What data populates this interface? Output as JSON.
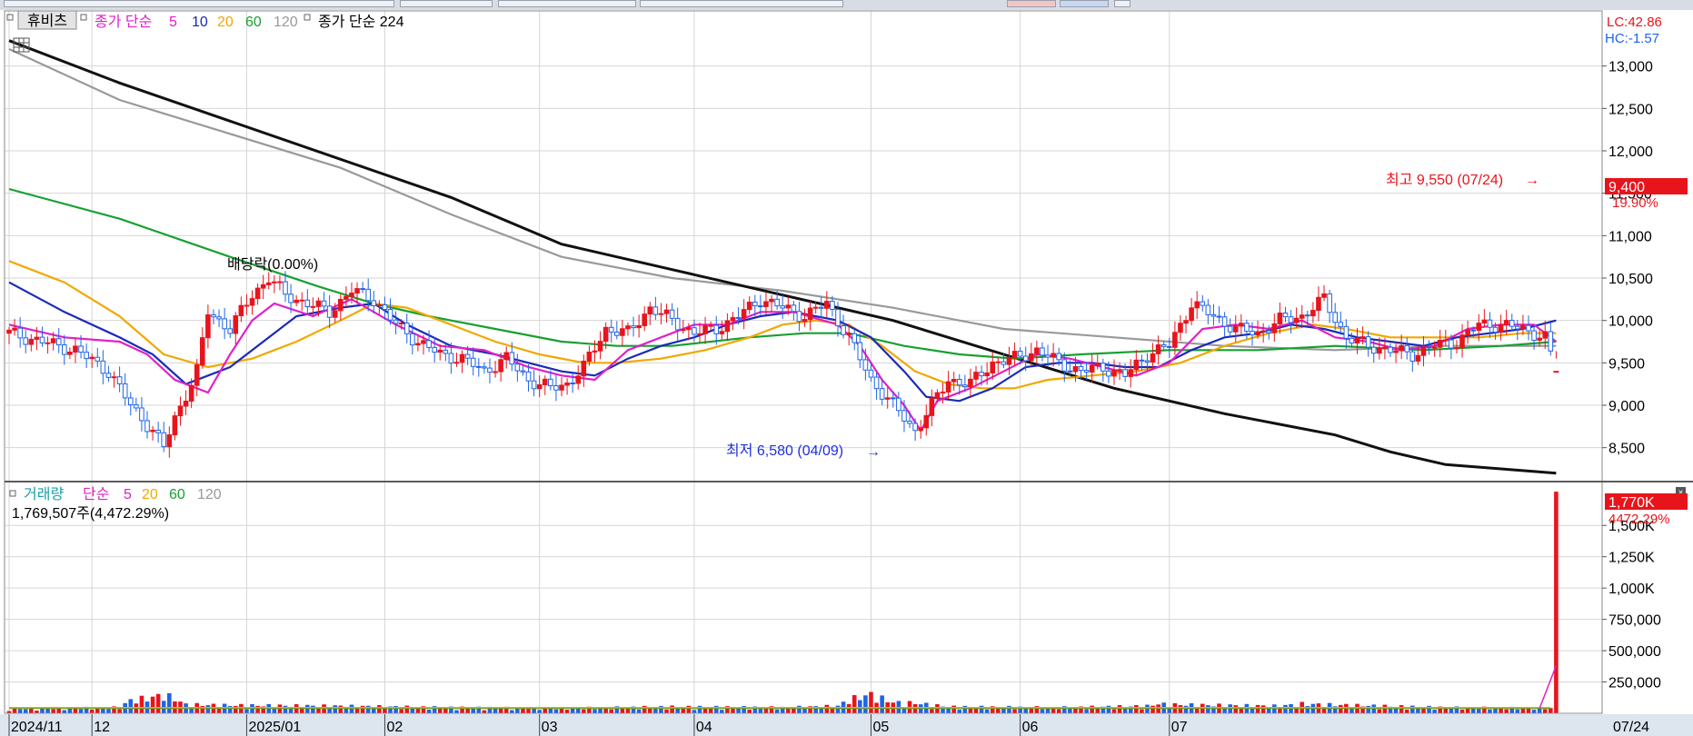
{
  "toolbar": {
    "stock_button": "휴비츠"
  },
  "price_legend": {
    "ma_prefix": "종가 단순",
    "periods": [
      "5",
      "10",
      "20",
      "60",
      "120"
    ],
    "ma_224_label": "종가 단순 224"
  },
  "volume_legend": {
    "title": "거래량",
    "prefix": "단순",
    "periods": [
      "5",
      "20",
      "60",
      "120"
    ],
    "value_text": "1,769,507주(4,472.29%)"
  },
  "colors": {
    "up": "#e8141c",
    "down": "#1e64e8",
    "ma5": "#e020c8",
    "ma10": "#1a2ab8",
    "ma20": "#f0a800",
    "ma60": "#18a030",
    "ma120": "#999999",
    "ma224": "#111111",
    "grid": "#d6d6d6"
  },
  "chart_data": [
    {
      "type": "candlestick",
      "title": "휴비츠",
      "y_ticks": [
        "13,000",
        "12,500",
        "12,000",
        "11,500",
        "11,000",
        "10,500",
        "10,000",
        "9,500",
        "9,000",
        "8,500"
      ],
      "ylim": [
        8100,
        13650
      ],
      "x_ticks": [
        "2024/11",
        "12",
        "2025/01",
        "02",
        "03",
        "04",
        "05",
        "06",
        "07"
      ],
      "last_date_label": "07/24",
      "indicators": {
        "lc": "LC:42.86",
        "hc": "HC:-1.57"
      },
      "current_price": "9,400",
      "current_change": "19.90%",
      "annotations": {
        "high": "최고 9,550 (07/24)",
        "low": "최저 6,580 (04/09)",
        "dividend": "배당락(0.00%)"
      },
      "ma_lines": {
        "ma5": [
          [
            0,
            9950
          ],
          [
            10,
            9800
          ],
          [
            20,
            9750
          ],
          [
            25,
            9600
          ],
          [
            30,
            9300
          ],
          [
            36,
            9150
          ],
          [
            40,
            9600
          ],
          [
            44,
            10000
          ],
          [
            48,
            10200
          ],
          [
            55,
            10050
          ],
          [
            62,
            10250
          ],
          [
            70,
            9950
          ],
          [
            78,
            9700
          ],
          [
            86,
            9650
          ],
          [
            94,
            9450
          ],
          [
            100,
            9350
          ],
          [
            106,
            9300
          ],
          [
            112,
            9650
          ],
          [
            118,
            9800
          ],
          [
            124,
            9950
          ],
          [
            130,
            9950
          ],
          [
            136,
            10100
          ],
          [
            142,
            10100
          ],
          [
            150,
            9950
          ],
          [
            154,
            9700
          ],
          [
            158,
            9300
          ],
          [
            162,
            9000
          ],
          [
            165,
            8700
          ],
          [
            168,
            9050
          ],
          [
            174,
            9200
          ],
          [
            180,
            9400
          ],
          [
            186,
            9600
          ],
          [
            192,
            9550
          ],
          [
            198,
            9450
          ],
          [
            204,
            9350
          ],
          [
            210,
            9500
          ],
          [
            216,
            9900
          ],
          [
            222,
            9950
          ],
          [
            228,
            9900
          ],
          [
            234,
            10000
          ],
          [
            240,
            9800
          ],
          [
            246,
            9750
          ],
          [
            252,
            9650
          ],
          [
            258,
            9700
          ],
          [
            264,
            9900
          ],
          [
            270,
            9950
          ],
          [
            276,
            9950
          ],
          [
            280,
            9750
          ]
        ],
        "ma10": [
          [
            0,
            10450
          ],
          [
            10,
            10100
          ],
          [
            20,
            9800
          ],
          [
            26,
            9600
          ],
          [
            32,
            9250
          ],
          [
            40,
            9450
          ],
          [
            46,
            9750
          ],
          [
            52,
            10050
          ],
          [
            60,
            10150
          ],
          [
            66,
            10200
          ],
          [
            72,
            9950
          ],
          [
            80,
            9700
          ],
          [
            88,
            9600
          ],
          [
            94,
            9500
          ],
          [
            100,
            9400
          ],
          [
            106,
            9350
          ],
          [
            112,
            9550
          ],
          [
            118,
            9700
          ],
          [
            124,
            9800
          ],
          [
            130,
            9950
          ],
          [
            136,
            10050
          ],
          [
            142,
            10100
          ],
          [
            150,
            10000
          ],
          [
            156,
            9800
          ],
          [
            162,
            9400
          ],
          [
            166,
            9100
          ],
          [
            172,
            9050
          ],
          [
            178,
            9200
          ],
          [
            184,
            9450
          ],
          [
            190,
            9500
          ],
          [
            196,
            9500
          ],
          [
            202,
            9450
          ],
          [
            208,
            9450
          ],
          [
            214,
            9650
          ],
          [
            220,
            9800
          ],
          [
            226,
            9850
          ],
          [
            232,
            9950
          ],
          [
            238,
            9900
          ],
          [
            244,
            9800
          ],
          [
            250,
            9750
          ],
          [
            256,
            9700
          ],
          [
            262,
            9800
          ],
          [
            268,
            9850
          ],
          [
            274,
            9900
          ],
          [
            280,
            10000
          ]
        ],
        "ma20": [
          [
            0,
            10700
          ],
          [
            10,
            10450
          ],
          [
            20,
            10050
          ],
          [
            28,
            9600
          ],
          [
            36,
            9450
          ],
          [
            44,
            9550
          ],
          [
            52,
            9750
          ],
          [
            60,
            10000
          ],
          [
            66,
            10200
          ],
          [
            72,
            10150
          ],
          [
            80,
            9950
          ],
          [
            88,
            9750
          ],
          [
            96,
            9600
          ],
          [
            104,
            9500
          ],
          [
            110,
            9500
          ],
          [
            118,
            9550
          ],
          [
            126,
            9650
          ],
          [
            134,
            9800
          ],
          [
            140,
            9950
          ],
          [
            146,
            10000
          ],
          [
            152,
            9950
          ],
          [
            158,
            9700
          ],
          [
            164,
            9400
          ],
          [
            170,
            9250
          ],
          [
            176,
            9200
          ],
          [
            182,
            9200
          ],
          [
            188,
            9300
          ],
          [
            196,
            9350
          ],
          [
            204,
            9400
          ],
          [
            212,
            9500
          ],
          [
            220,
            9700
          ],
          [
            228,
            9850
          ],
          [
            236,
            9950
          ],
          [
            242,
            9900
          ],
          [
            250,
            9800
          ],
          [
            258,
            9800
          ],
          [
            266,
            9800
          ],
          [
            274,
            9850
          ],
          [
            280,
            9850
          ]
        ],
        "ma60": [
          [
            0,
            11550
          ],
          [
            20,
            11200
          ],
          [
            40,
            10750
          ],
          [
            56,
            10400
          ],
          [
            66,
            10200
          ],
          [
            76,
            10050
          ],
          [
            88,
            9900
          ],
          [
            100,
            9750
          ],
          [
            110,
            9700
          ],
          [
            120,
            9700
          ],
          [
            134,
            9800
          ],
          [
            144,
            9850
          ],
          [
            152,
            9850
          ],
          [
            162,
            9700
          ],
          [
            172,
            9600
          ],
          [
            182,
            9550
          ],
          [
            194,
            9600
          ],
          [
            210,
            9650
          ],
          [
            226,
            9650
          ],
          [
            240,
            9700
          ],
          [
            256,
            9650
          ],
          [
            270,
            9700
          ],
          [
            280,
            9750
          ]
        ],
        "ma120": [
          [
            0,
            13200
          ],
          [
            20,
            12600
          ],
          [
            40,
            12200
          ],
          [
            60,
            11800
          ],
          [
            80,
            11250
          ],
          [
            100,
            10750
          ],
          [
            120,
            10500
          ],
          [
            140,
            10350
          ],
          [
            160,
            10150
          ],
          [
            180,
            9900
          ],
          [
            200,
            9800
          ],
          [
            220,
            9700
          ],
          [
            240,
            9650
          ],
          [
            260,
            9700
          ],
          [
            280,
            9700
          ]
        ],
        "ma224": [
          [
            0,
            13300
          ],
          [
            20,
            12800
          ],
          [
            40,
            12350
          ],
          [
            60,
            11900
          ],
          [
            80,
            11450
          ],
          [
            100,
            10900
          ],
          [
            120,
            10600
          ],
          [
            140,
            10300
          ],
          [
            160,
            10000
          ],
          [
            180,
            9600
          ],
          [
            200,
            9200
          ],
          [
            220,
            8900
          ],
          [
            240,
            8650
          ],
          [
            250,
            8450
          ],
          [
            260,
            8300
          ],
          [
            270,
            8250
          ],
          [
            280,
            8200
          ]
        ]
      },
      "candle_path": [
        [
          0,
          9850
        ],
        [
          6,
          9750
        ],
        [
          12,
          9650
        ],
        [
          18,
          9400
        ],
        [
          22,
          9000
        ],
        [
          26,
          8700
        ],
        [
          28,
          8500
        ],
        [
          30,
          8850
        ],
        [
          34,
          9400
        ],
        [
          36,
          10100
        ],
        [
          40,
          9900
        ],
        [
          44,
          10300
        ],
        [
          47,
          10500
        ],
        [
          50,
          10300
        ],
        [
          54,
          10200
        ],
        [
          58,
          10100
        ],
        [
          62,
          10350
        ],
        [
          66,
          10250
        ],
        [
          70,
          9950
        ],
        [
          74,
          9750
        ],
        [
          78,
          9600
        ],
        [
          82,
          9550
        ],
        [
          86,
          9400
        ],
        [
          90,
          9550
        ],
        [
          94,
          9300
        ],
        [
          98,
          9200
        ],
        [
          101,
          9250
        ],
        [
          104,
          9450
        ],
        [
          108,
          9900
        ],
        [
          112,
          9850
        ],
        [
          116,
          10150
        ],
        [
          120,
          10000
        ],
        [
          124,
          9850
        ],
        [
          128,
          9900
        ],
        [
          132,
          10050
        ],
        [
          136,
          10250
        ],
        [
          140,
          10150
        ],
        [
          144,
          10050
        ],
        [
          148,
          10200
        ],
        [
          152,
          9800
        ],
        [
          156,
          9300
        ],
        [
          160,
          9000
        ],
        [
          164,
          8700
        ],
        [
          166,
          8900
        ],
        [
          170,
          9300
        ],
        [
          174,
          9250
        ],
        [
          178,
          9500
        ],
        [
          182,
          9550
        ],
        [
          186,
          9650
        ],
        [
          190,
          9500
        ],
        [
          194,
          9400
        ],
        [
          198,
          9450
        ],
        [
          202,
          9350
        ],
        [
          206,
          9600
        ],
        [
          210,
          9700
        ],
        [
          214,
          10200
        ],
        [
          218,
          10050
        ],
        [
          222,
          9900
        ],
        [
          226,
          9850
        ],
        [
          230,
          10000
        ],
        [
          234,
          10050
        ],
        [
          238,
          10250
        ],
        [
          242,
          9800
        ],
        [
          246,
          9700
        ],
        [
          250,
          9650
        ],
        [
          254,
          9600
        ],
        [
          258,
          9700
        ],
        [
          262,
          9750
        ],
        [
          266,
          9950
        ],
        [
          270,
          9950
        ],
        [
          274,
          9900
        ],
        [
          278,
          9800
        ],
        [
          280,
          9400
        ]
      ],
      "last_candle": {
        "index": 280,
        "open": 9550,
        "high": 9550,
        "close": 9400,
        "low": 9550
      }
    },
    {
      "type": "bar",
      "title": "거래량",
      "y_ticks": [
        "1,500K",
        "1,250K",
        "1,000K",
        "750,000",
        "500,000",
        "250,000"
      ],
      "ylim": [
        0,
        1850000
      ],
      "current_volume": "1,770K",
      "current_pct": "4472.29%",
      "last_volume": 1769507,
      "volume_path": [
        [
          0,
          30000
        ],
        [
          20,
          40000
        ],
        [
          22,
          90000
        ],
        [
          26,
          110000
        ],
        [
          28,
          130000
        ],
        [
          30,
          100000
        ],
        [
          32,
          60000
        ],
        [
          40,
          55000
        ],
        [
          60,
          50000
        ],
        [
          80,
          40000
        ],
        [
          100,
          35000
        ],
        [
          120,
          45000
        ],
        [
          140,
          40000
        ],
        [
          150,
          50000
        ],
        [
          152,
          95000
        ],
        [
          156,
          130000
        ],
        [
          160,
          75000
        ],
        [
          164,
          70000
        ],
        [
          170,
          45000
        ],
        [
          190,
          40000
        ],
        [
          206,
          50000
        ],
        [
          208,
          65000
        ],
        [
          210,
          60000
        ],
        [
          230,
          50000
        ],
        [
          234,
          65000
        ],
        [
          238,
          60000
        ],
        [
          260,
          40000
        ],
        [
          279,
          35000
        ],
        [
          280,
          1769507
        ]
      ]
    }
  ]
}
